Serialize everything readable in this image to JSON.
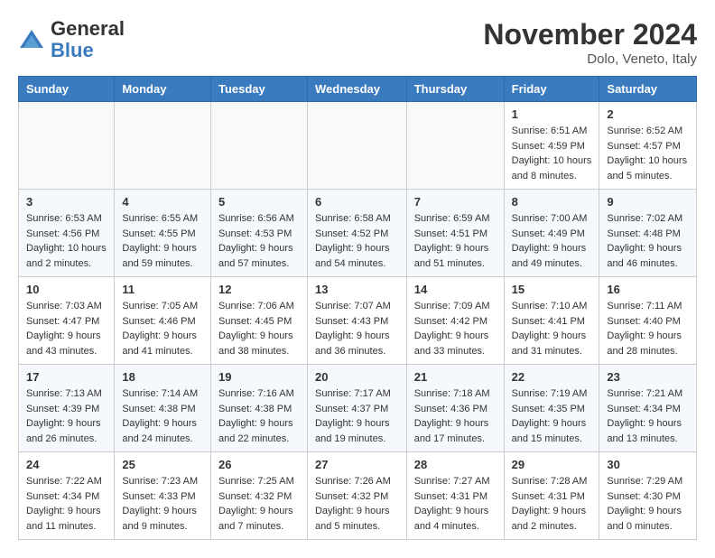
{
  "header": {
    "logo": {
      "general": "General",
      "blue": "Blue"
    },
    "month": "November 2024",
    "location": "Dolo, Veneto, Italy"
  },
  "weekdays": [
    "Sunday",
    "Monday",
    "Tuesday",
    "Wednesday",
    "Thursday",
    "Friday",
    "Saturday"
  ],
  "weeks": [
    [
      {
        "day": "",
        "info": ""
      },
      {
        "day": "",
        "info": ""
      },
      {
        "day": "",
        "info": ""
      },
      {
        "day": "",
        "info": ""
      },
      {
        "day": "",
        "info": ""
      },
      {
        "day": "1",
        "info": "Sunrise: 6:51 AM\nSunset: 4:59 PM\nDaylight: 10 hours and 8 minutes."
      },
      {
        "day": "2",
        "info": "Sunrise: 6:52 AM\nSunset: 4:57 PM\nDaylight: 10 hours and 5 minutes."
      }
    ],
    [
      {
        "day": "3",
        "info": "Sunrise: 6:53 AM\nSunset: 4:56 PM\nDaylight: 10 hours and 2 minutes."
      },
      {
        "day": "4",
        "info": "Sunrise: 6:55 AM\nSunset: 4:55 PM\nDaylight: 9 hours and 59 minutes."
      },
      {
        "day": "5",
        "info": "Sunrise: 6:56 AM\nSunset: 4:53 PM\nDaylight: 9 hours and 57 minutes."
      },
      {
        "day": "6",
        "info": "Sunrise: 6:58 AM\nSunset: 4:52 PM\nDaylight: 9 hours and 54 minutes."
      },
      {
        "day": "7",
        "info": "Sunrise: 6:59 AM\nSunset: 4:51 PM\nDaylight: 9 hours and 51 minutes."
      },
      {
        "day": "8",
        "info": "Sunrise: 7:00 AM\nSunset: 4:49 PM\nDaylight: 9 hours and 49 minutes."
      },
      {
        "day": "9",
        "info": "Sunrise: 7:02 AM\nSunset: 4:48 PM\nDaylight: 9 hours and 46 minutes."
      }
    ],
    [
      {
        "day": "10",
        "info": "Sunrise: 7:03 AM\nSunset: 4:47 PM\nDaylight: 9 hours and 43 minutes."
      },
      {
        "day": "11",
        "info": "Sunrise: 7:05 AM\nSunset: 4:46 PM\nDaylight: 9 hours and 41 minutes."
      },
      {
        "day": "12",
        "info": "Sunrise: 7:06 AM\nSunset: 4:45 PM\nDaylight: 9 hours and 38 minutes."
      },
      {
        "day": "13",
        "info": "Sunrise: 7:07 AM\nSunset: 4:43 PM\nDaylight: 9 hours and 36 minutes."
      },
      {
        "day": "14",
        "info": "Sunrise: 7:09 AM\nSunset: 4:42 PM\nDaylight: 9 hours and 33 minutes."
      },
      {
        "day": "15",
        "info": "Sunrise: 7:10 AM\nSunset: 4:41 PM\nDaylight: 9 hours and 31 minutes."
      },
      {
        "day": "16",
        "info": "Sunrise: 7:11 AM\nSunset: 4:40 PM\nDaylight: 9 hours and 28 minutes."
      }
    ],
    [
      {
        "day": "17",
        "info": "Sunrise: 7:13 AM\nSunset: 4:39 PM\nDaylight: 9 hours and 26 minutes."
      },
      {
        "day": "18",
        "info": "Sunrise: 7:14 AM\nSunset: 4:38 PM\nDaylight: 9 hours and 24 minutes."
      },
      {
        "day": "19",
        "info": "Sunrise: 7:16 AM\nSunset: 4:38 PM\nDaylight: 9 hours and 22 minutes."
      },
      {
        "day": "20",
        "info": "Sunrise: 7:17 AM\nSunset: 4:37 PM\nDaylight: 9 hours and 19 minutes."
      },
      {
        "day": "21",
        "info": "Sunrise: 7:18 AM\nSunset: 4:36 PM\nDaylight: 9 hours and 17 minutes."
      },
      {
        "day": "22",
        "info": "Sunrise: 7:19 AM\nSunset: 4:35 PM\nDaylight: 9 hours and 15 minutes."
      },
      {
        "day": "23",
        "info": "Sunrise: 7:21 AM\nSunset: 4:34 PM\nDaylight: 9 hours and 13 minutes."
      }
    ],
    [
      {
        "day": "24",
        "info": "Sunrise: 7:22 AM\nSunset: 4:34 PM\nDaylight: 9 hours and 11 minutes."
      },
      {
        "day": "25",
        "info": "Sunrise: 7:23 AM\nSunset: 4:33 PM\nDaylight: 9 hours and 9 minutes."
      },
      {
        "day": "26",
        "info": "Sunrise: 7:25 AM\nSunset: 4:32 PM\nDaylight: 9 hours and 7 minutes."
      },
      {
        "day": "27",
        "info": "Sunrise: 7:26 AM\nSunset: 4:32 PM\nDaylight: 9 hours and 5 minutes."
      },
      {
        "day": "28",
        "info": "Sunrise: 7:27 AM\nSunset: 4:31 PM\nDaylight: 9 hours and 4 minutes."
      },
      {
        "day": "29",
        "info": "Sunrise: 7:28 AM\nSunset: 4:31 PM\nDaylight: 9 hours and 2 minutes."
      },
      {
        "day": "30",
        "info": "Sunrise: 7:29 AM\nSunset: 4:30 PM\nDaylight: 9 hours and 0 minutes."
      }
    ]
  ]
}
